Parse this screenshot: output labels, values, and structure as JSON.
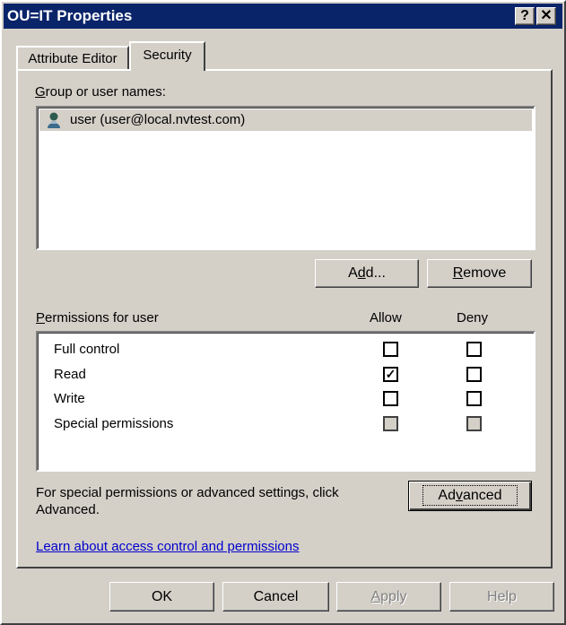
{
  "window": {
    "title": "OU=IT Properties",
    "help_btn": "?",
    "close_btn": "✕"
  },
  "tabs": [
    {
      "label": "Attribute Editor",
      "active": false
    },
    {
      "label": "Security",
      "active": true
    }
  ],
  "group_section": {
    "label_pre": "",
    "label_u": "G",
    "label_rest": "roup or user names:",
    "users": [
      {
        "name": "user (user@local.nvtest.com)",
        "icon": "user-icon"
      }
    ]
  },
  "buttons": {
    "add_pre": "A",
    "add_u": "d",
    "add_post": "d...",
    "remove_u": "R",
    "remove_post": "emove",
    "advanced_pre": "Ad",
    "advanced_u": "v",
    "advanced_post": "anced",
    "ok": "OK",
    "cancel": "Cancel",
    "apply_u": "A",
    "apply_post": "pply",
    "help": "Help"
  },
  "permissions": {
    "label_u": "P",
    "label_rest": "ermissions for user",
    "allow_header": "Allow",
    "deny_header": "Deny",
    "rows": [
      {
        "name": "Full control",
        "allow": "",
        "deny": ""
      },
      {
        "name": "Read",
        "allow": "✓",
        "deny": ""
      },
      {
        "name": "Write",
        "allow": "",
        "deny": ""
      },
      {
        "name": "Special permissions",
        "allow": "",
        "deny": ""
      }
    ]
  },
  "advanced_note": {
    "line1": "For special permissions or advanced settings, click",
    "line2": "Advanced."
  },
  "learn_link": "Learn about access control and permissions",
  "colors": {
    "titlebar": "#0a246a",
    "link": "#0000cc",
    "selection": "#d4d0c8"
  }
}
